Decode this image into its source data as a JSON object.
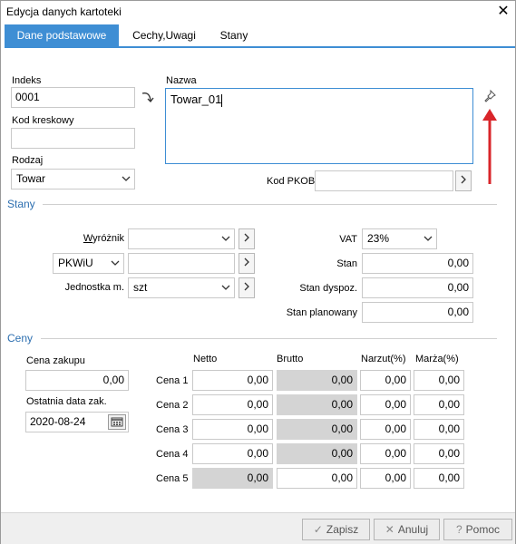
{
  "window": {
    "title": "Edycja danych kartoteki",
    "close_glyph": "✕"
  },
  "tabs": [
    {
      "label": "Dane podstawowe",
      "active": true
    },
    {
      "label": "Cechy,Uwagi",
      "active": false
    },
    {
      "label": "Stany",
      "active": false
    }
  ],
  "basic": {
    "indeks_label": "Indeks",
    "indeks_value": "0001",
    "nazwa_label": "Nazwa",
    "nazwa_value": "Towar_01",
    "kod_kreskowy_label": "Kod kreskowy",
    "kod_kreskowy_value": "",
    "rodzaj_label": "Rodzaj",
    "rodzaj_value": "Towar",
    "kod_pkob_label": "Kod PKOB",
    "kod_pkob_value": ""
  },
  "stany": {
    "section_label": "Stany",
    "wyroznik_label": "Wyróżnik",
    "wyroznik_value": "",
    "pkwiu_label": "PKWiU",
    "pkwiu_value": "",
    "jednostka_label": "Jednostka m.",
    "jednostka_value": "szt",
    "vat_label": "VAT",
    "vat_value": "23%",
    "stan_label": "Stan",
    "stan_value": "0,00",
    "stan_dyspoz_label": "Stan dyspoz.",
    "stan_dyspoz_value": "0,00",
    "stan_planowany_label": "Stan planowany",
    "stan_planowany_value": "0,00"
  },
  "ceny": {
    "section_label": "Ceny",
    "cena_zakupu_label": "Cena zakupu",
    "cena_zakupu_value": "0,00",
    "ostatnia_data_label": "Ostatnia data zak.",
    "ostatnia_data_value": "2020-08-24",
    "headers": {
      "netto": "Netto",
      "brutto": "Brutto",
      "narzut": "Narzut(%)",
      "marza": "Marża(%)"
    },
    "rows": [
      {
        "label": "Cena 1",
        "netto": "0,00",
        "brutto": "0,00",
        "narzut": "0,00",
        "marza": "0,00"
      },
      {
        "label": "Cena 2",
        "netto": "0,00",
        "brutto": "0,00",
        "narzut": "0,00",
        "marza": "0,00"
      },
      {
        "label": "Cena 3",
        "netto": "0,00",
        "brutto": "0,00",
        "narzut": "0,00",
        "marza": "0,00"
      },
      {
        "label": "Cena 4",
        "netto": "0,00",
        "brutto": "0,00",
        "narzut": "0,00",
        "marza": "0,00"
      },
      {
        "label": "Cena 5",
        "netto": "0,00",
        "brutto": "0,00",
        "narzut": "0,00",
        "marza": "0,00"
      }
    ]
  },
  "footer": {
    "zapisz": "Zapisz",
    "anuluj": "Anuluj",
    "pomoc": "Pomoc"
  },
  "colors": {
    "accent": "#3e8ed4",
    "section": "#2d6fb0",
    "annotation_arrow": "#d9252a"
  },
  "icons": [
    "close-icon",
    "chevron-down-icon",
    "chevron-right-icon",
    "pin-icon",
    "calendar-icon",
    "check-icon",
    "x-icon",
    "help-icon",
    "curved-arrow-icon",
    "red-arrow-icon"
  ]
}
